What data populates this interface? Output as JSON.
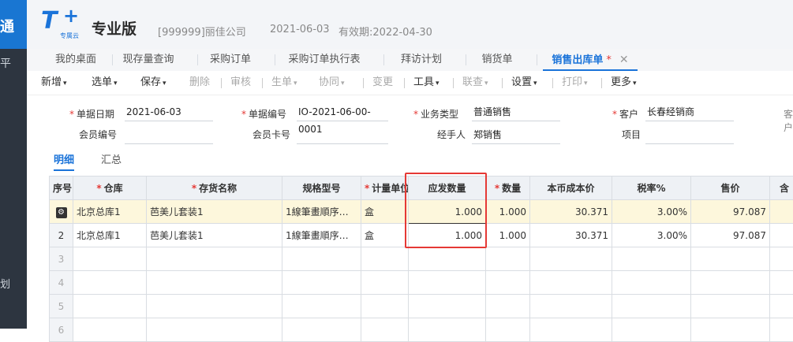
{
  "sidebar": {
    "logo_text": "通",
    "item_top": "平",
    "item_bottom": "划"
  },
  "header": {
    "brand_t": "T",
    "brand_plus": "+",
    "brand_sub": "专属云",
    "edition": "专业版",
    "company": "[999999]丽佳公司",
    "date": "2021-06-03",
    "validity": "有效期:2022-04-30"
  },
  "tabs": [
    {
      "label": "我的桌面"
    },
    {
      "label": "现存量查询"
    },
    {
      "label": "采购订单"
    },
    {
      "label": "采购订单执行表"
    },
    {
      "label": "拜访计划"
    },
    {
      "label": "销货单"
    },
    {
      "label": "销售出库单",
      "modified": "*",
      "close": "✕"
    }
  ],
  "toolbar": [
    {
      "label": "新增",
      "caret": "▾",
      "enabled": true
    },
    {
      "label": "选单",
      "caret": "▾",
      "enabled": true
    },
    {
      "label": "保存",
      "caret": "▾",
      "enabled": true
    },
    {
      "label": "删除",
      "enabled": false
    },
    {
      "label": "审核",
      "enabled": false
    },
    {
      "label": "生单",
      "caret": "▾",
      "enabled": false
    },
    {
      "label": "协同",
      "caret": "▾",
      "enabled": false
    },
    {
      "label": "变更",
      "enabled": false
    },
    {
      "label": "工具",
      "caret": "▾",
      "enabled": true
    },
    {
      "label": "联查",
      "caret": "▾",
      "enabled": false
    },
    {
      "label": "设置",
      "caret": "▾",
      "enabled": true
    },
    {
      "label": "打印",
      "caret": "▾",
      "enabled": false
    },
    {
      "label": "更多",
      "caret": "▾",
      "enabled": true
    }
  ],
  "form": {
    "doc_date_label": "单据日期",
    "doc_date": "2021-06-03",
    "doc_no_label": "单据编号",
    "doc_no": "IO-2021-06-00-0001",
    "biz_type_label": "业务类型",
    "biz_type": "普通销售",
    "customer_label": "客户",
    "customer": "长春经销商",
    "customer2_label": "客户",
    "member_no_label": "会员编号",
    "member_no": "",
    "member_card_label": "会员卡号",
    "member_card": "",
    "handler_label": "经手人",
    "handler": "郑销售",
    "project_label": "项目",
    "project": "",
    "required_mark": "*"
  },
  "subtabs": {
    "detail": "明细",
    "summary": "汇总"
  },
  "grid": {
    "headers": {
      "seq": "序号",
      "warehouse": "仓库",
      "item_name": "存货名称",
      "spec": "规格型号",
      "unit": "计量单位",
      "should_qty": "应发数量",
      "qty": "数量",
      "cost": "本币成本价",
      "tax_rate": "税率%",
      "price": "售价",
      "more": "含"
    },
    "required_mark": "*",
    "rows": [
      {
        "seq": "",
        "warehouse": "北京总库1",
        "item_name": "芭美儿套装1",
        "spec": "1線筆畫順序…",
        "unit": "盒",
        "should_qty": "1.000",
        "qty": "1.000",
        "cost": "30.371",
        "tax_rate": "3.00%",
        "price": "97.087"
      },
      {
        "seq": "2",
        "warehouse": "北京总库1",
        "item_name": "芭美儿套装1",
        "spec": "1線筆畫順序…",
        "unit": "盒",
        "should_qty": "1.000",
        "qty": "1.000",
        "cost": "30.371",
        "tax_rate": "3.00%",
        "price": "97.087"
      }
    ],
    "empty_rows": [
      "3",
      "4",
      "5",
      "6"
    ]
  }
}
